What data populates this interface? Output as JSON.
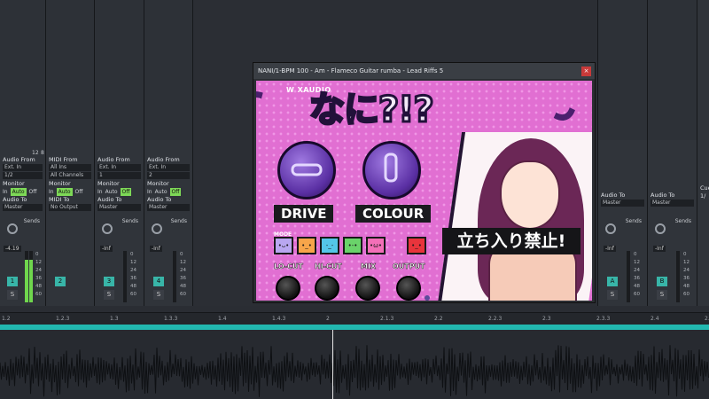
{
  "daw": {
    "strips_left": [
      {
        "audio_from_label": "Audio From",
        "audio_from": "Ext. In",
        "channel": "1/2",
        "monitor_label": "Monitor",
        "monitor_opts": [
          "In",
          "Auto",
          "Off"
        ],
        "audio_to_label": "Audio To",
        "audio_to": "Master",
        "sends": "Sends",
        "track_num": "1",
        "meter_val": "-4.19",
        "track_header": "12"
      },
      {
        "audio_from_label": "MIDI From",
        "audio_from": "All Ins",
        "channel": "All Channels",
        "monitor_label": "Monitor",
        "monitor_opts": [
          "In",
          "Auto",
          "Off"
        ],
        "audio_to_label": "MIDI To",
        "audio_to": "No Output",
        "sends": "",
        "track_num": "2",
        "meter_val": "",
        "track_header": "8"
      },
      {
        "audio_from_label": "Audio From",
        "audio_from": "Ext. In",
        "channel": "1",
        "monitor_label": "Monitor",
        "monitor_opts": [
          "In",
          "Auto",
          "Off"
        ],
        "audio_to_label": "Audio To",
        "audio_to": "Master",
        "sends": "Sends",
        "track_num": "3",
        "meter_val": "-Inf",
        "track_header": ""
      },
      {
        "audio_from_label": "Audio From",
        "audio_from": "Ext. In",
        "channel": "2",
        "monitor_label": "Monitor",
        "monitor_opts": [
          "In",
          "Auto",
          "Off"
        ],
        "audio_to_label": "Audio To",
        "audio_to": "Master",
        "sends": "Sends",
        "track_num": "4",
        "meter_val": "-Inf",
        "track_header": ""
      }
    ],
    "strips_right": [
      {
        "audio_to_label": "Audio To",
        "audio_to": "Master",
        "sends": "Sends",
        "track_num": "A",
        "meter_val": "-Inf"
      },
      {
        "audio_to_label": "Audio To",
        "audio_to": "Master",
        "sends": "Sends",
        "track_num": "B",
        "meter_val": "-Inf"
      },
      {
        "audio_to_label": "Cue",
        "audio_to": "1/",
        "sends": "",
        "track_num": "",
        "meter_val": ""
      }
    ],
    "meter_scale": [
      "0",
      "12",
      "24",
      "36",
      "48",
      "60"
    ],
    "solo_label": "S",
    "timeline_ticks": [
      "1.2",
      "1.2.3",
      "1.3",
      "1.3.3",
      "1.4",
      "1.4.3",
      "2",
      "2.1.3",
      "2.2",
      "2.2.3",
      "2.3",
      "2.3.3",
      "2.4",
      "2.4.3"
    ]
  },
  "plugin": {
    "window_title": "NANI/1-BPM 100 - Am - Flameco Guitar rumba - Lead Riffs 5",
    "close": "×",
    "brand": "W XAUDIO",
    "logo": "なに?!?",
    "drive_label": "DRIVE",
    "colour_label": "COLOUR",
    "mode_label": "MODE",
    "mode_faces": [
      "•ᴗ•",
      "•_•",
      "-_-",
      "•-•",
      "•ω•",
      "•_•"
    ],
    "mode_colors": [
      "#b9a7f0",
      "#f7a54a",
      "#54c7e8",
      "#6ad36a",
      "#f36fb8",
      "#e8343c"
    ],
    "ellipsis": "...",
    "small_knobs": [
      "LO-CUT",
      "HI-CUT",
      "MIX",
      "OUTPUT"
    ],
    "banner": "立ち入り禁止!"
  }
}
